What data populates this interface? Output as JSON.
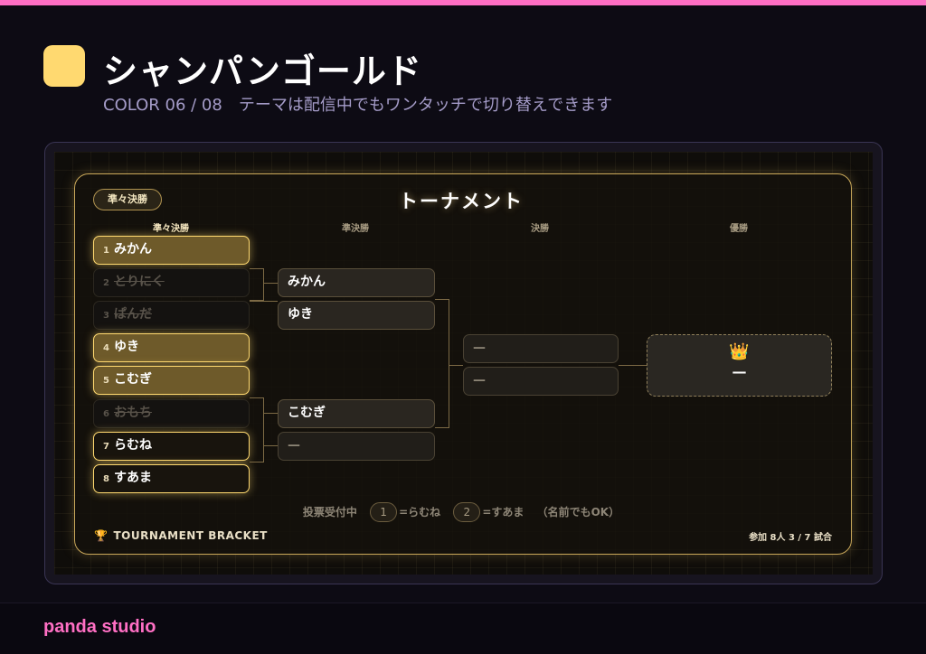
{
  "header": {
    "swatch_color": "#ffd970",
    "title": "シャンパンゴールド",
    "subtitle": "COLOR 06 / 08　テーマは配信中でもワンタッチで切り替えできます"
  },
  "bracket": {
    "round_badge": "準々決勝",
    "title": "トーナメント",
    "columns": [
      "準々決勝",
      "準決勝",
      "決勝",
      "優勝"
    ],
    "quarterfinal": [
      {
        "num": "1",
        "name": "みかん",
        "state": "win"
      },
      {
        "num": "2",
        "name": "とりにく",
        "state": "out"
      },
      {
        "num": "3",
        "name": "ぱんだ",
        "state": "out"
      },
      {
        "num": "4",
        "name": "ゆき",
        "state": "win"
      },
      {
        "num": "5",
        "name": "こむぎ",
        "state": "win"
      },
      {
        "num": "6",
        "name": "おもち",
        "state": "out"
      },
      {
        "num": "7",
        "name": "らむね",
        "state": "active"
      },
      {
        "num": "8",
        "name": "すあま",
        "state": "active"
      }
    ],
    "semifinal": [
      "みかん",
      "ゆき",
      "こむぎ",
      "—"
    ],
    "final": [
      "—",
      "—"
    ],
    "champion": {
      "icon": "crown-icon",
      "glyph": "👑",
      "name": "—"
    },
    "vote": {
      "label": "投票受付中",
      "option1_key": "1",
      "option1_text": "=らむね",
      "option2_key": "2",
      "option2_text": "=すあま",
      "note": "（名前でもOK）"
    },
    "footer_left": "TOURNAMENT BRACKET",
    "footer_right": "参加 8人 3 / 7 試合"
  },
  "brand": "panda studio"
}
